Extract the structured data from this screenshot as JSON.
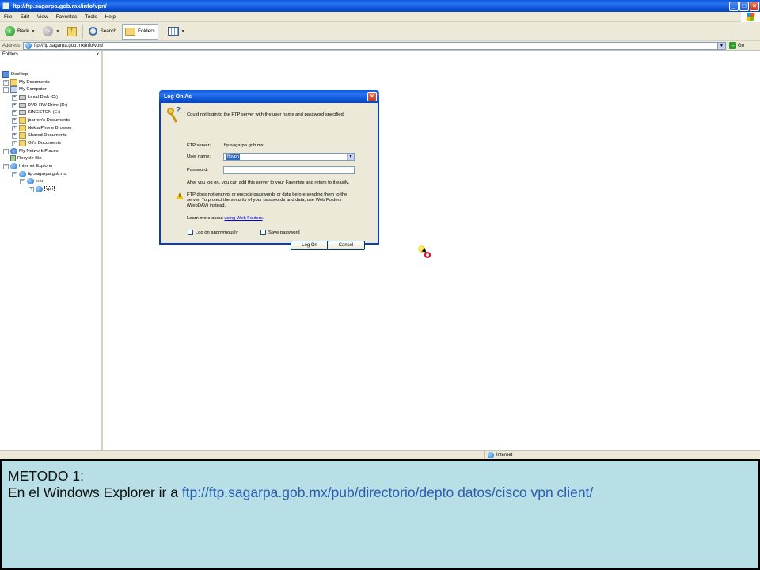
{
  "window": {
    "title": "ftp://ftp.sagarpa.gob.mx/info/vpn/"
  },
  "menu": [
    "File",
    "Edit",
    "View",
    "Favorites",
    "Tools",
    "Help"
  ],
  "toolbar": {
    "back": "Back",
    "search": "Search",
    "folders": "Folders"
  },
  "address": {
    "label": "Address",
    "value": "ftp://ftp.sagarpa.gob.mx/info/vpn/",
    "go": "Go"
  },
  "folders_pane": {
    "title": "Folders",
    "close": "x",
    "items": [
      {
        "label": "Desktop",
        "icon": "desktop-icon"
      },
      {
        "label": "My Documents",
        "icon": "folder-icon"
      },
      {
        "label": "My Computer",
        "icon": "computer-icon"
      },
      {
        "label": "Local Disk (C:)",
        "icon": "drive-icon"
      },
      {
        "label": "DVD-RW Drive (D:)",
        "icon": "drive-icon"
      },
      {
        "label": "KINGSTON (E:)",
        "icon": "drive-icon"
      },
      {
        "label": "jbarron's Documents",
        "icon": "folder-icon"
      },
      {
        "label": "Nokia Phone Browser",
        "icon": "folder-icon"
      },
      {
        "label": "Shared Documents",
        "icon": "folder-icon"
      },
      {
        "label": "Oli's Documents",
        "icon": "folder-icon"
      },
      {
        "label": "My Network Places",
        "icon": "network-icon"
      },
      {
        "label": "Recycle Bin",
        "icon": "recycle-bin-icon"
      },
      {
        "label": "Internet Explorer",
        "icon": "internet-explorer-icon"
      },
      {
        "label": "ftp.sagarpa.gob.mx",
        "icon": "ftp-site-icon"
      },
      {
        "label": "info",
        "icon": "folder-icon"
      },
      {
        "label": "vpn",
        "icon": "folder-icon"
      }
    ]
  },
  "dialog": {
    "title": "Log On As",
    "message": "Could not login to the FTP server with the user name and password specified.",
    "ftp_server_label": "FTP server:",
    "ftp_server_value": "ftp.sagarpa.gob.mx",
    "username_label": "User name:",
    "username_value": "ftpvpn",
    "password_label": "Password:",
    "password_value": "",
    "favorites_note": "After you log on, you can add this server to your Favorites and return to it easily.",
    "warning_line1": "FTP does not encrypt or encode passwords or data before sending them to the",
    "warning_line2": "server.  To protect the security of your passwords and data, use Web Folders",
    "warning_line3": "(WebDAV) instead.",
    "learn_more_prefix": "Learn more about",
    "learn_more_link": "using Web Folders",
    "learn_more_suffix": ".",
    "anonymous_label": "Log on anonymously",
    "save_password_label": "Save password",
    "logon_button": "Log On",
    "cancel_button": "Cancel"
  },
  "statusbar": {
    "zone": "Internet"
  },
  "caption": {
    "line1": "METODO 1:",
    "line2_prefix": "En el Windows Explorer ir a ",
    "line2_url": "ftp://ftp.sagarpa.gob.mx/pub/directorio/depto datos/cisco vpn client/"
  }
}
